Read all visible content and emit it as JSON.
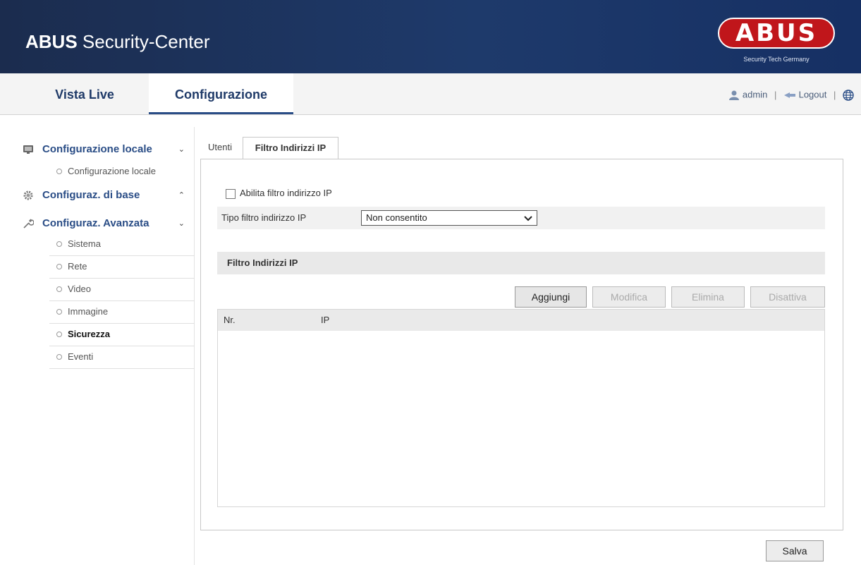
{
  "header": {
    "title_bold": "ABUS",
    "title_rest": " Security-Center",
    "logo_text": "ABUS",
    "logo_tagline": "Security Tech Germany"
  },
  "nav": {
    "tabs": [
      {
        "label": "Vista Live",
        "active": false
      },
      {
        "label": "Configurazione",
        "active": true
      }
    ],
    "user": "admin",
    "separator": "|",
    "logout": "Logout",
    "icons": {
      "user": "user-icon",
      "logout": "logout-icon",
      "language": "globe-icon"
    }
  },
  "sidebar": {
    "local": {
      "label": "Configurazione locale",
      "chevron": "⌄",
      "icon": "monitor-icon",
      "items": [
        "Configurazione locale"
      ]
    },
    "basic": {
      "label": "Configuraz. di base",
      "chevron": "⌃",
      "icon": "gear-icon"
    },
    "advanced": {
      "label": "Configuraz. Avanzata",
      "chevron": "⌄",
      "icon": "wrench-icon",
      "items": [
        "Sistema",
        "Rete",
        "Video",
        "Immagine",
        "Sicurezza",
        "Eventi"
      ],
      "active": "Sicurezza"
    }
  },
  "content": {
    "tabs": [
      {
        "label": "Utenti",
        "active": false
      },
      {
        "label": "Filtro Indirizzi IP",
        "active": true
      }
    ],
    "enable_checkbox": {
      "label": "Abilita filtro indirizzo IP",
      "checked": false
    },
    "filter_type": {
      "label": "Tipo filtro indirizzo IP",
      "value": "Non consentito"
    },
    "section_title": "Filtro Indirizzi IP",
    "buttons": {
      "add": "Aggiungi",
      "edit": "Modifica",
      "delete": "Elimina",
      "disable": "Disattiva"
    },
    "table": {
      "columns": [
        "Nr.",
        "IP"
      ],
      "rows": []
    },
    "save": "Salva"
  }
}
